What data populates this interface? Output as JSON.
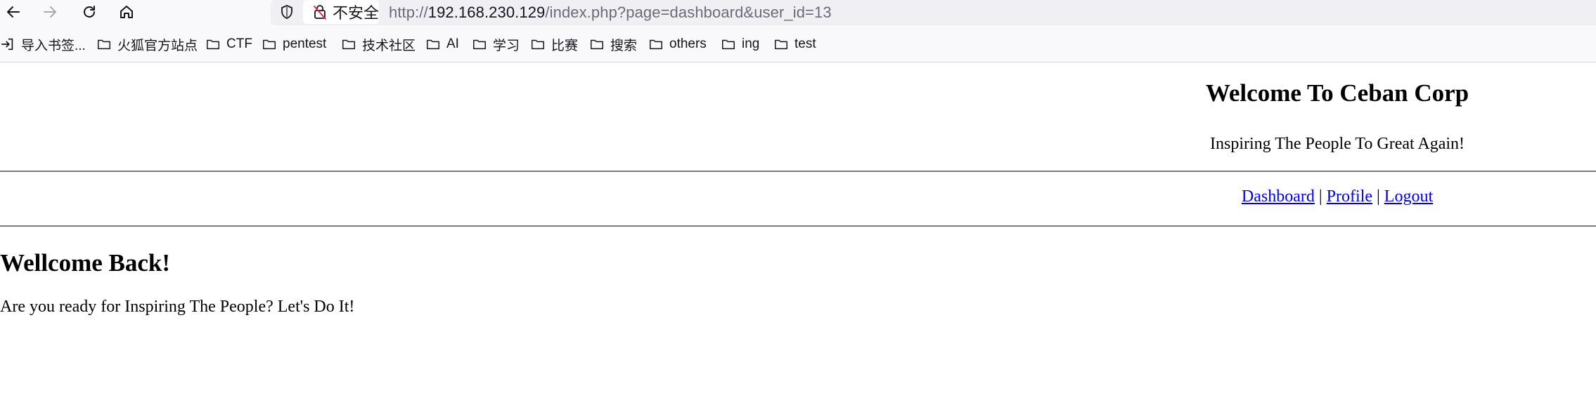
{
  "browser": {
    "url_scheme": "http://",
    "url_host": "192.168.230.129",
    "url_path": "/index.php?page=dashboard&user_id=13",
    "security_label": "不安全"
  },
  "bookmarks": [
    {
      "label": "导入书签...",
      "icon": "import-icon"
    },
    {
      "label": "火狐官方站点",
      "icon": "folder-icon"
    },
    {
      "label": "CTF",
      "icon": "folder-icon"
    },
    {
      "label": "pentest",
      "icon": "folder-icon"
    },
    {
      "label": "技术社区",
      "icon": "folder-icon"
    },
    {
      "label": "AI",
      "icon": "folder-icon"
    },
    {
      "label": "学习",
      "icon": "folder-icon"
    },
    {
      "label": "比赛",
      "icon": "folder-icon"
    },
    {
      "label": "搜索",
      "icon": "folder-icon"
    },
    {
      "label": "others",
      "icon": "folder-icon"
    },
    {
      "label": "ing",
      "icon": "folder-icon"
    },
    {
      "label": "test",
      "icon": "folder-icon"
    }
  ],
  "site": {
    "title": "Welcome To Ceban Corp",
    "tagline": "Inspiring The People To Great Again!"
  },
  "menu": {
    "dashboard": "Dashboard",
    "profile": "Profile",
    "logout": "Logout",
    "separator": " | "
  },
  "main": {
    "heading": "Wellcome Back!",
    "text": "Are you ready for Inspiring The People? Let's Do It!"
  },
  "colors": {
    "link": "#0000ee",
    "insecure_lock": "#e22850",
    "chrome_bg": "#f9f9fb",
    "urlbar_bg": "#f0f0f4"
  }
}
